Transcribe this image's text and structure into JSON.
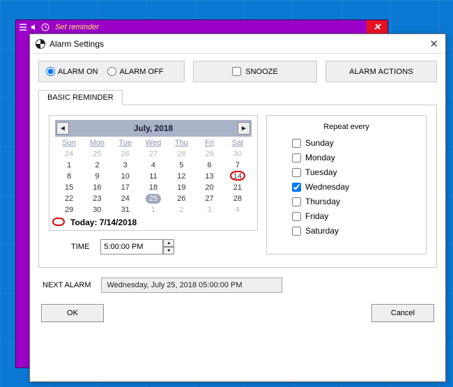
{
  "purple": {
    "title": "Set reminder"
  },
  "dialog": {
    "title": "Alarm Settings",
    "top": {
      "alarm_on": "ALARM ON",
      "alarm_off": "ALARM OFF",
      "alarm_state": "on",
      "snooze": "SNOOZE",
      "snooze_checked": false,
      "actions": "ALARM ACTIONS"
    },
    "tab_label": "BASIC REMINDER",
    "calendar": {
      "month_label": "July, 2018",
      "dow": [
        "Sun",
        "Mon",
        "Tue",
        "Wed",
        "Thu",
        "Fri",
        "Sat"
      ],
      "weeks": [
        [
          {
            "d": 24,
            "o": 1
          },
          {
            "d": 25,
            "o": 1
          },
          {
            "d": 26,
            "o": 1
          },
          {
            "d": 27,
            "o": 1
          },
          {
            "d": 28,
            "o": 1
          },
          {
            "d": 29,
            "o": 1
          },
          {
            "d": 30,
            "o": 1
          }
        ],
        [
          {
            "d": 1
          },
          {
            "d": 2
          },
          {
            "d": 3
          },
          {
            "d": 4
          },
          {
            "d": 5
          },
          {
            "d": 6
          },
          {
            "d": 7
          }
        ],
        [
          {
            "d": 8
          },
          {
            "d": 9
          },
          {
            "d": 10
          },
          {
            "d": 11
          },
          {
            "d": 12
          },
          {
            "d": 13
          },
          {
            "d": 14,
            "today": 1
          }
        ],
        [
          {
            "d": 15
          },
          {
            "d": 16
          },
          {
            "d": 17
          },
          {
            "d": 18
          },
          {
            "d": 19
          },
          {
            "d": 20
          },
          {
            "d": 21
          }
        ],
        [
          {
            "d": 22
          },
          {
            "d": 23
          },
          {
            "d": 24
          },
          {
            "d": 25,
            "sel": 1
          },
          {
            "d": 26
          },
          {
            "d": 27
          },
          {
            "d": 28
          }
        ],
        [
          {
            "d": 29
          },
          {
            "d": 30
          },
          {
            "d": 31
          },
          {
            "d": 1,
            "o": 1
          },
          {
            "d": 2,
            "o": 1
          },
          {
            "d": 3,
            "o": 1
          },
          {
            "d": 4,
            "o": 1
          }
        ]
      ],
      "today_label": "Today: 7/14/2018"
    },
    "time": {
      "label": "TIME",
      "value": "5:00:00 PM"
    },
    "repeat": {
      "title": "Repeat every",
      "days": [
        {
          "label": "Sunday",
          "checked": false
        },
        {
          "label": "Monday",
          "checked": false
        },
        {
          "label": "Tuesday",
          "checked": false
        },
        {
          "label": "Wednesday",
          "checked": true
        },
        {
          "label": "Thursday",
          "checked": false
        },
        {
          "label": "Friday",
          "checked": false
        },
        {
          "label": "Saturday",
          "checked": false
        }
      ]
    },
    "next": {
      "label": "NEXT ALARM",
      "value": "Wednesday, July 25, 2018 05:00:00 PM"
    },
    "buttons": {
      "ok": "OK",
      "cancel": "Cancel"
    }
  }
}
